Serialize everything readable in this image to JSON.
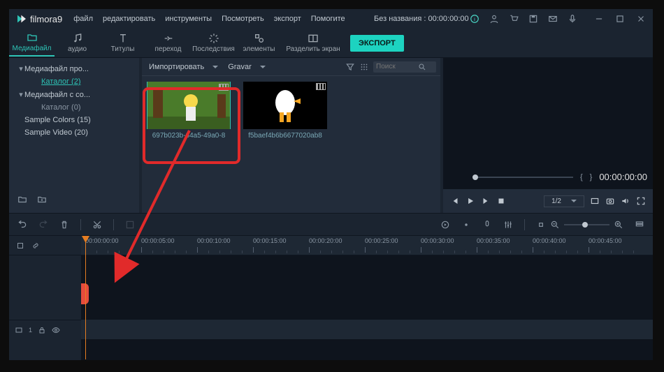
{
  "titlebar": {
    "appname": "filmora9",
    "menu": [
      "файл",
      "редактировать",
      "инструменты",
      "Посмотреть",
      "экспорт",
      "Помогите"
    ],
    "document_title": "Без названия : 00:00:00:00"
  },
  "tabs": [
    {
      "label": "Медиафайл"
    },
    {
      "label": "аудио"
    },
    {
      "label": "Титулы"
    },
    {
      "label": "переход"
    },
    {
      "label": "Последствия"
    },
    {
      "label": "элементы"
    },
    {
      "label": "Разделить экран"
    }
  ],
  "export_btn": "ЭКСПОРТ",
  "sidebar": [
    {
      "label": "Медиафайл про...",
      "expandable": true
    },
    {
      "label": "Каталог (2)",
      "active": true,
      "child": true
    },
    {
      "label": "Медиафайл с со...",
      "expandable": true
    },
    {
      "label": "Каталог (0)",
      "child": true
    },
    {
      "label": "Sample Colors (15)"
    },
    {
      "label": "Sample Video (20)"
    }
  ],
  "media_toolbar": {
    "import": "Импортировать",
    "record": "Gravar",
    "search_placeholder": "Поиск"
  },
  "media_items": [
    {
      "name": "697b023b-64a5-49a0-8"
    },
    {
      "name": "f5baef4b6b6677020ab8"
    }
  ],
  "preview": {
    "brackets_left": "{",
    "brackets_right": "}",
    "current_time": "00:00:00:00",
    "speed": "1/2"
  },
  "timeline": {
    "track1_label": "1",
    "ruler": [
      "00:00:00:00",
      "00:00:05:00",
      "00:00:10:00",
      "00:00:15:00",
      "00:00:20:00",
      "00:00:25:00",
      "00:00:30:00",
      "00:00:35:00",
      "00:00:40:00",
      "00:00:45:00"
    ]
  }
}
